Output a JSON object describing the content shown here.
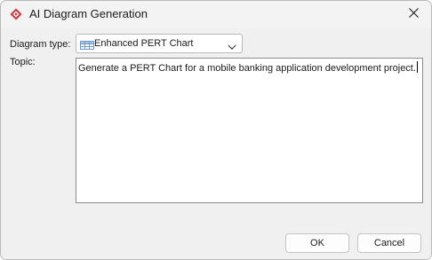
{
  "window": {
    "title": "AI Diagram Generation",
    "icon": "app-logo-icon",
    "close_icon": "close-icon"
  },
  "form": {
    "diagram_type_label": "Diagram type:",
    "diagram_type_value": "Enhanced PERT Chart",
    "diagram_type_icon": "table-icon",
    "topic_label": "Topic:",
    "topic_value": "Generate a PERT Chart for a mobile banking application development project."
  },
  "buttons": {
    "ok_label": "OK",
    "cancel_label": "Cancel"
  },
  "colors": {
    "logo": "#d0333a",
    "dialog_bg": "#f0f0f0",
    "titlebar_bg": "#f3f3f3",
    "table_icon": "#6f9bd1"
  }
}
